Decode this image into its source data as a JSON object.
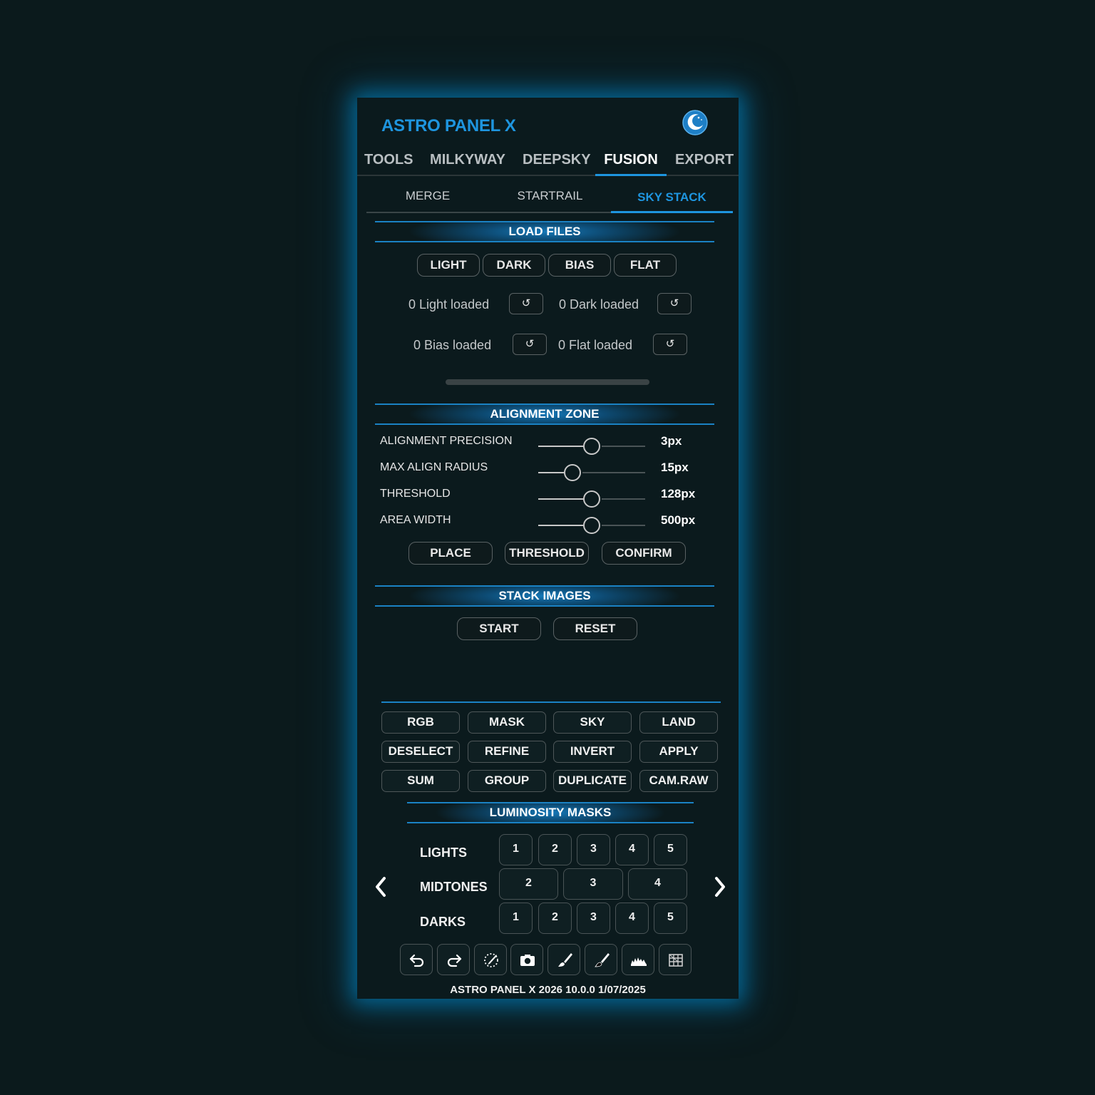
{
  "app": {
    "title": "ASTRO PANEL X"
  },
  "main_tabs": [
    "TOOLS",
    "MILKYWAY",
    "DEEPSKY",
    "FUSION",
    "EXPORT"
  ],
  "active_main_tab": "FUSION",
  "sub_tabs": [
    "MERGE",
    "STARTRAIL",
    "SKY STACK"
  ],
  "active_sub_tab": "SKY STACK",
  "load_files": {
    "header": "LOAD FILES",
    "buttons": [
      "LIGHT",
      "DARK",
      "BIAS",
      "FLAT"
    ],
    "status": {
      "light": "0 Light loaded",
      "dark": "0 Dark loaded",
      "bias": "0 Bias loaded",
      "flat": "0 Flat loaded"
    },
    "reset_glyph": "↺",
    "progress": 0
  },
  "alignment": {
    "header": "ALIGNMENT ZONE",
    "sliders": [
      {
        "label": "ALIGNMENT PRECISION",
        "value": "3px",
        "fraction": 0.5
      },
      {
        "label": "MAX ALIGN RADIUS",
        "value": "15px",
        "fraction": 0.32
      },
      {
        "label": "THRESHOLD",
        "value": "128px",
        "fraction": 0.5
      },
      {
        "label": "AREA WIDTH",
        "value": "500px",
        "fraction": 0.5
      }
    ],
    "buttons": [
      "PLACE",
      "THRESHOLD",
      "CONFIRM"
    ]
  },
  "stack": {
    "header": "STACK IMAGES",
    "buttons": [
      "START",
      "RESET"
    ]
  },
  "grid_buttons": [
    [
      "RGB",
      "MASK",
      "SKY",
      "LAND"
    ],
    [
      "DESELECT",
      "REFINE",
      "INVERT",
      "APPLY"
    ],
    [
      "SUM",
      "GROUP",
      "DUPLICATE",
      "CAM.RAW"
    ]
  ],
  "luminosity": {
    "header": "LUMINOSITY MASKS",
    "lights_label": "LIGHTS",
    "midtones_label": "MIDTONES",
    "darks_label": "DARKS",
    "lights": [
      "1",
      "2",
      "3",
      "4",
      "5"
    ],
    "midtones": [
      "2",
      "3",
      "4"
    ],
    "darks": [
      "1",
      "2",
      "3",
      "4",
      "5"
    ]
  },
  "toolbar_icons": [
    "undo-icon",
    "redo-icon",
    "dotted-brush-icon",
    "camera-icon",
    "brush-white-icon",
    "brush-black-icon",
    "histogram-icon",
    "grid-icon"
  ],
  "colors": {
    "accent": "#1e95df",
    "background": "#0b1a1c",
    "glow": "#0096dc"
  },
  "footer": "ASTRO PANEL X 2026 10.0.0 1/07/2025"
}
